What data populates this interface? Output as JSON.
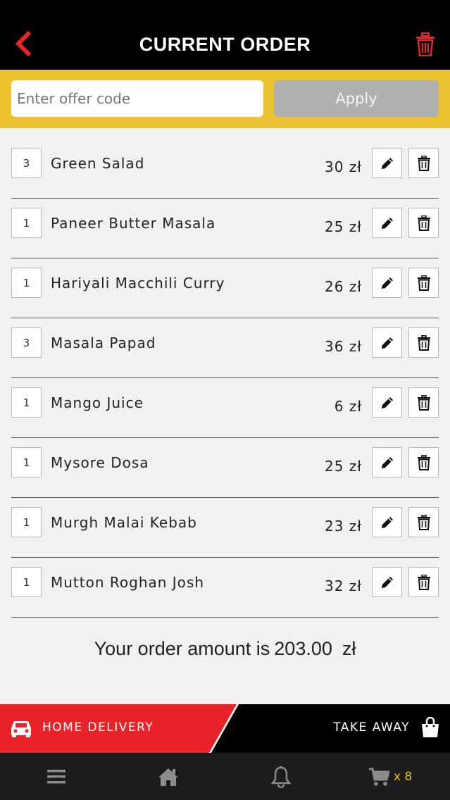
{
  "header": {
    "title": "CURRENT ORDER",
    "back_icon": "chevron-left-icon",
    "trash_icon": "trash-icon",
    "accent_color": "#e8232a"
  },
  "offer": {
    "placeholder": "Enter offer code",
    "value": "",
    "apply_label": "Apply",
    "bar_color": "#ecc12f"
  },
  "items": [
    {
      "qty": "3",
      "name": "Green Salad",
      "price": "30 zł"
    },
    {
      "qty": "1",
      "name": "Paneer Butter Masala",
      "price": "25 zł"
    },
    {
      "qty": "1",
      "name": "Hariyali Macchili Curry",
      "price": "26 zł"
    },
    {
      "qty": "3",
      "name": "Masala Papad",
      "price": "36 zł"
    },
    {
      "qty": "1",
      "name": "Mango Juice",
      "price": "6 zł"
    },
    {
      "qty": "1",
      "name": "Mysore Dosa",
      "price": "25 zł"
    },
    {
      "qty": "1",
      "name": "Murgh Malai Kebab",
      "price": "23 zł"
    },
    {
      "qty": "1",
      "name": "Mutton Roghan Josh",
      "price": "32 zł"
    }
  ],
  "summary": {
    "prefix": "Your order amount is",
    "amount": "203.00",
    "currency": "zł"
  },
  "delivery": {
    "home_label": "HOME DELIVERY",
    "home_icon": "car-icon",
    "takeaway_label": "TAKE AWAY",
    "takeaway_icon": "shopping-bag-icon"
  },
  "tabbar": {
    "cart_count": "x 8",
    "icons": [
      "menu-icon",
      "home-icon",
      "bell-icon",
      "cart-icon"
    ]
  }
}
